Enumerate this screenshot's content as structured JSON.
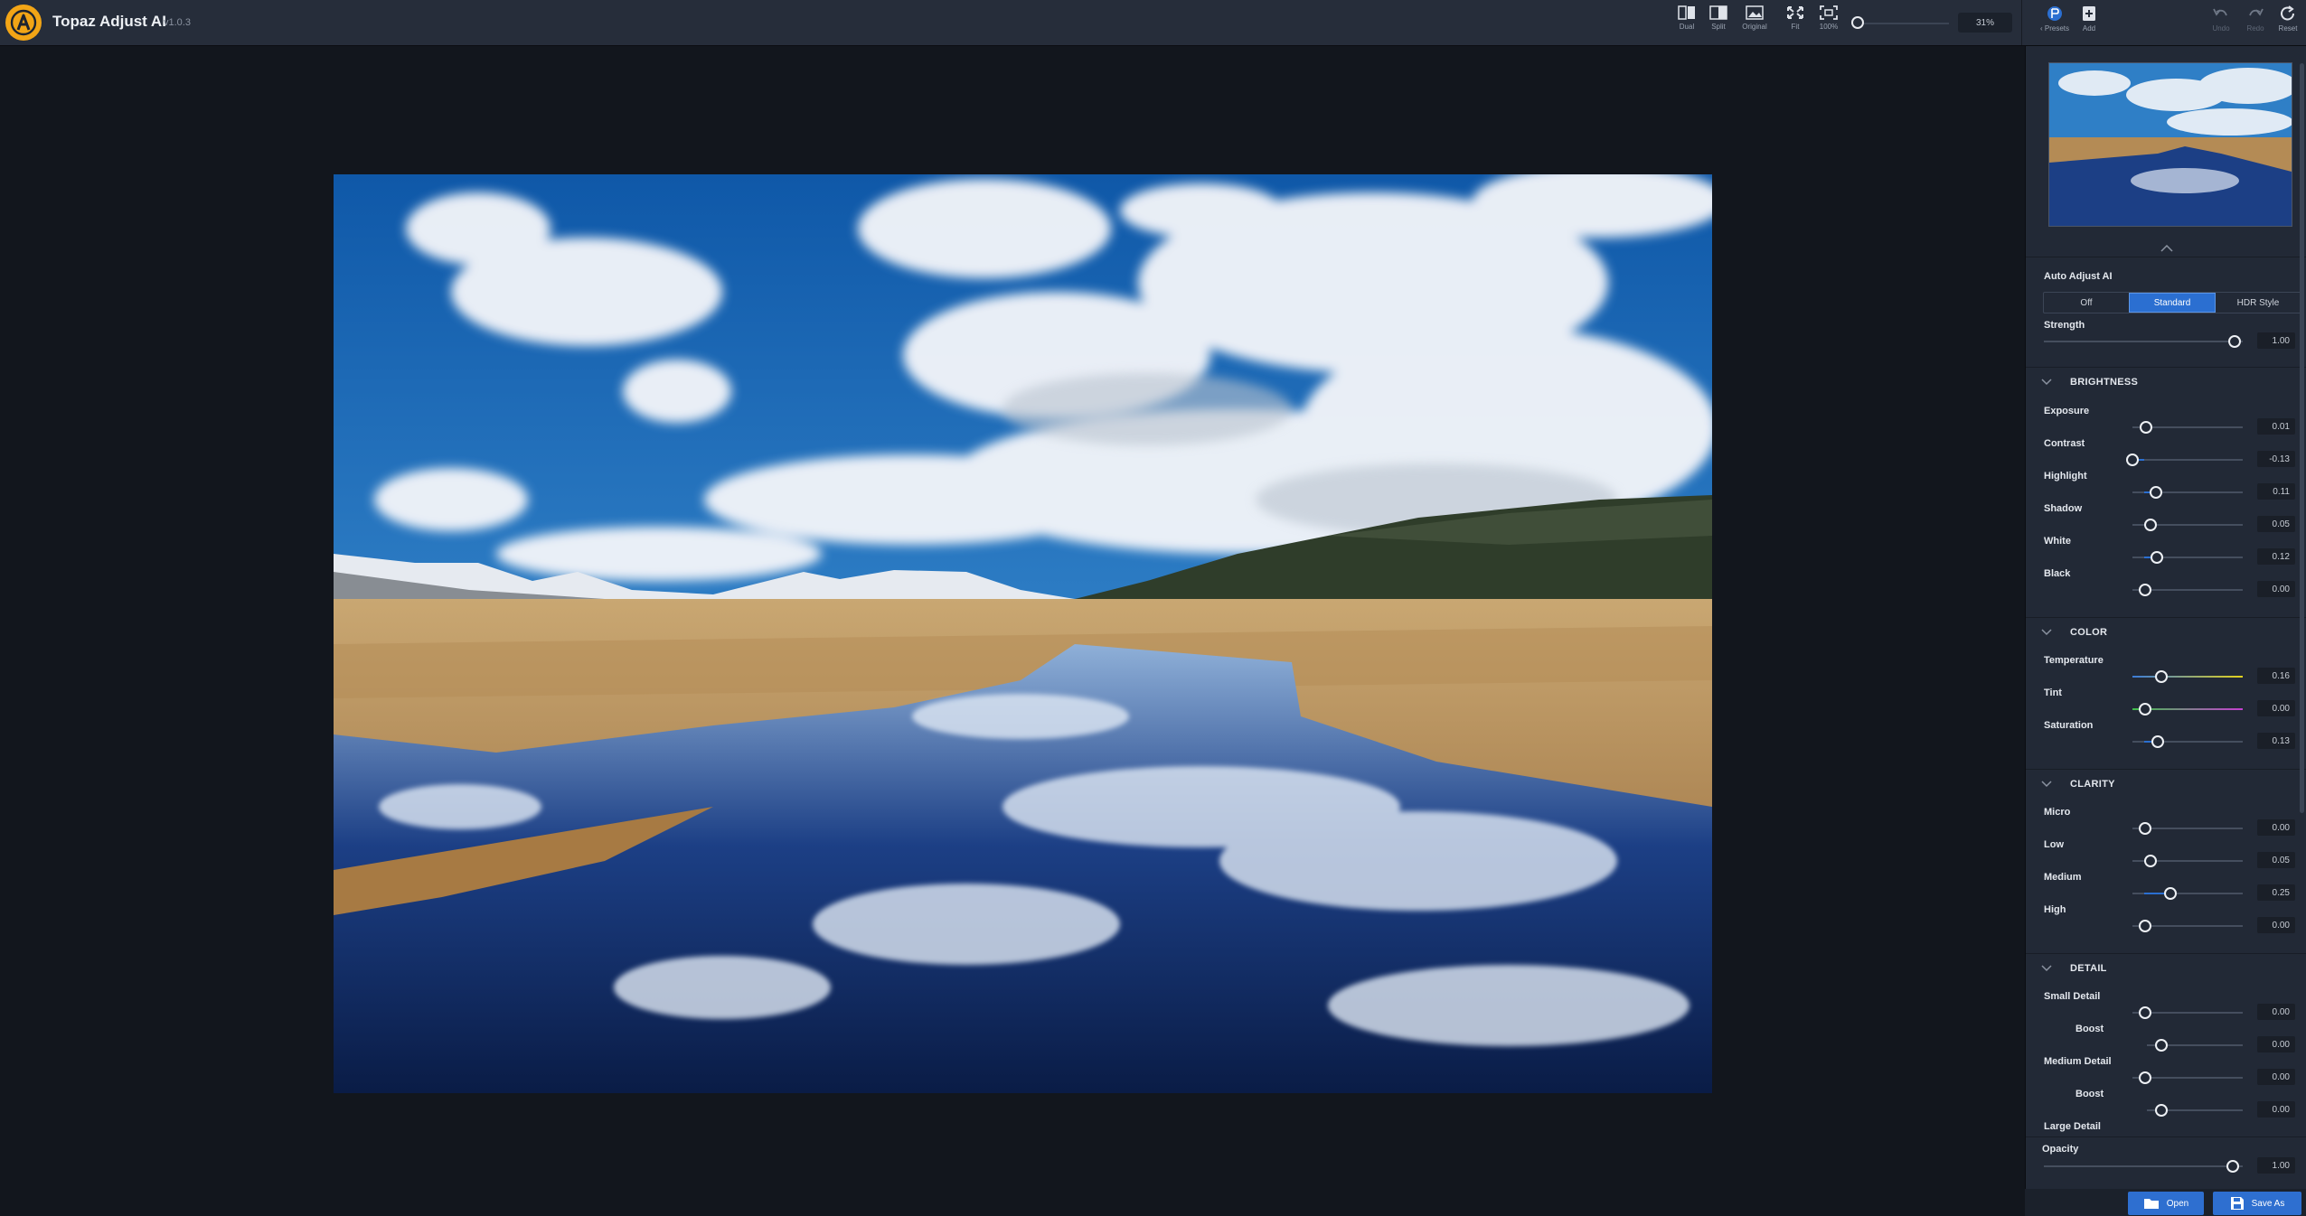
{
  "app": {
    "title": "Topaz Adjust AI",
    "version": "v1.0.3"
  },
  "toolbar": {
    "view_buttons": [
      {
        "label": "Dual",
        "icon": "dual-view-icon"
      },
      {
        "label": "Split",
        "icon": "split-view-icon"
      },
      {
        "label": "Original",
        "icon": "original-view-icon"
      }
    ],
    "fit_label": "Fit",
    "zoom100_label": "100%",
    "zoom_value": "31%",
    "presets_label": "Presets",
    "add_label": "Add",
    "undo_label": "Undo",
    "redo_label": "Redo",
    "reset_label": "Reset"
  },
  "auto_adjust": {
    "title": "Auto Adjust AI",
    "options": [
      "Off",
      "Standard",
      "HDR Style"
    ],
    "selected": "Standard",
    "strength_label": "Strength",
    "strength_value": "1.00",
    "strength_level": 1.0
  },
  "sections": {
    "brightness": {
      "title": "BRIGHTNESS",
      "sliders": [
        {
          "label": "Exposure",
          "value": "0.01",
          "level": 0.01
        },
        {
          "label": "Contrast",
          "value": "-0.13",
          "level": -0.13
        },
        {
          "label": "Highlight",
          "value": "0.11",
          "level": 0.11
        },
        {
          "label": "Shadow",
          "value": "0.05",
          "level": 0.05
        },
        {
          "label": "White",
          "value": "0.12",
          "level": 0.12
        },
        {
          "label": "Black",
          "value": "0.00",
          "level": 0.0
        }
      ]
    },
    "color": {
      "title": "COLOR",
      "sliders": [
        {
          "label": "Temperature",
          "value": "0.16",
          "level": 0.16
        },
        {
          "label": "Tint",
          "value": "0.00",
          "level": 0.0
        },
        {
          "label": "Saturation",
          "value": "0.13",
          "level": 0.13
        }
      ]
    },
    "clarity": {
      "title": "CLARITY",
      "sliders": [
        {
          "label": "Micro",
          "value": "0.00",
          "level": 0.0
        },
        {
          "label": "Low",
          "value": "0.05",
          "level": 0.05
        },
        {
          "label": "Medium",
          "value": "0.25",
          "level": 0.25
        },
        {
          "label": "High",
          "value": "0.00",
          "level": 0.0
        }
      ]
    },
    "detail": {
      "title": "DETAIL",
      "sliders": [
        {
          "label": "Small Detail",
          "value": "0.00",
          "level": 0.0
        },
        {
          "label": "Boost",
          "value": "0.00",
          "level": 0.0
        },
        {
          "label": "Medium Detail",
          "value": "0.00",
          "level": 0.0
        },
        {
          "label": "Boost",
          "value": "0.00",
          "level": 0.0
        },
        {
          "label": "Large Detail",
          "value": "",
          "level": 0.0
        }
      ]
    }
  },
  "opacity": {
    "label": "Opacity",
    "value": "1.00",
    "level": 1.0
  },
  "actions": {
    "open_label": "Open",
    "save_as_label": "Save As"
  },
  "colors": {
    "accent": "#2b6fd1",
    "logo": "#f2a516",
    "temperature_gradient": [
      "#3b7bd8",
      "#e3d21c"
    ],
    "tint_gradient": [
      "#3fbf4a",
      "#c53fd1"
    ]
  }
}
